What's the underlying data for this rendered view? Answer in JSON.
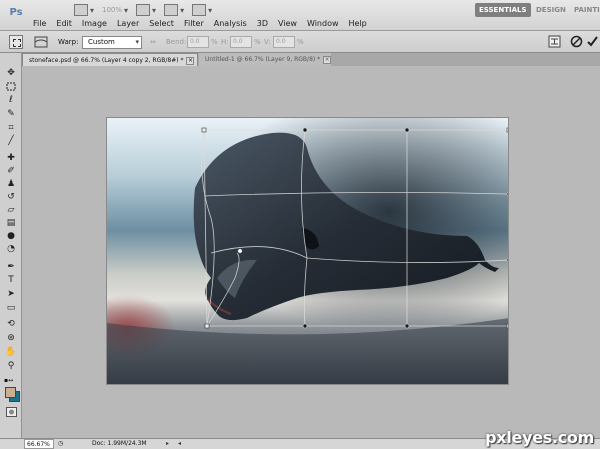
{
  "app": {
    "logo": "Ps"
  },
  "menu": [
    "File",
    "Edit",
    "Image",
    "Layer",
    "Select",
    "Filter",
    "Analysis",
    "3D",
    "View",
    "Window",
    "Help"
  ],
  "menu_tools": {
    "zoom": "100%"
  },
  "workspaces": [
    "ESSENTIALS",
    "DESIGN",
    "PAINTI"
  ],
  "options": {
    "warp_label": "Warp:",
    "warp_value": "Custom",
    "bend_label": "Bend:",
    "bend_value": "0.0",
    "h_label": "H:",
    "h_value": "0.0",
    "v_label": "V:",
    "v_value": "0.0",
    "pct": "%"
  },
  "tabs": [
    {
      "label": "stoneface.psd @ 66.7% (Layer 4 copy 2, RGB/8#) *"
    },
    {
      "label": "Untitled-1 @ 66.7% (Layer 9, RGB/8) *"
    }
  ],
  "tools": [
    "move-icon",
    "marquee-icon",
    "lasso-icon",
    "quick-select-icon",
    "crop-icon",
    "eyedropper-icon",
    "healing-icon",
    "brush-icon",
    "clone-stamp-icon",
    "history-brush-icon",
    "eraser-icon",
    "gradient-icon",
    "blur-icon",
    "dodge-icon",
    "pen-icon",
    "type-icon",
    "path-select-icon",
    "shape-icon",
    "3d-rotate-icon",
    "3d-orbit-icon",
    "hand-icon",
    "zoom-icon"
  ],
  "colors": {
    "foreground": "#c9b093",
    "background": "#1e6f8c",
    "accent": "#7f7f7f"
  },
  "status": {
    "zoom": "66.67%",
    "doc": "Doc: 1.99M/24.3M"
  },
  "watermark": "pxleyes.com"
}
